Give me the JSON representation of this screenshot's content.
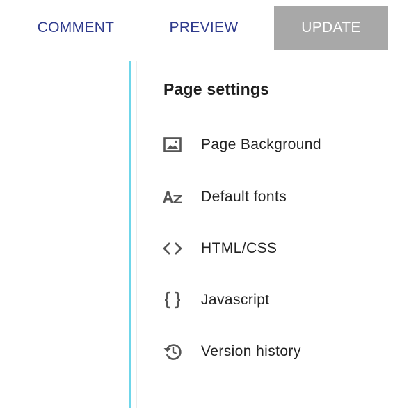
{
  "toolbar": {
    "comment_label": "COMMENT",
    "preview_label": "PREVIEW",
    "update_label": "UPDATE"
  },
  "panel": {
    "title": "Page settings",
    "items": [
      {
        "label": "Page Background",
        "icon": "image-icon"
      },
      {
        "label": "Default fonts",
        "icon": "font-az-icon"
      },
      {
        "label": "HTML/CSS",
        "icon": "code-icon"
      },
      {
        "label": "Javascript",
        "icon": "curly-braces-icon"
      },
      {
        "label": "Version history",
        "icon": "history-icon"
      }
    ]
  },
  "colors": {
    "link_blue": "#2e3a8c",
    "update_bg": "#a8a8a8",
    "canvas_edge": "#6fd6ea"
  }
}
